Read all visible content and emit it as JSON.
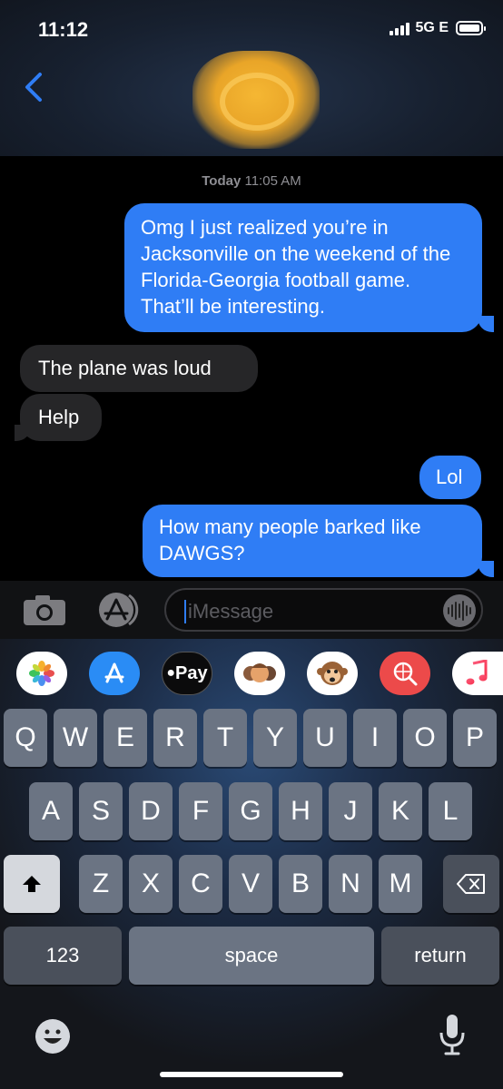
{
  "status_bar": {
    "time": "11:12",
    "network": "5G E",
    "signal_bars": 4,
    "battery_level": 1.0
  },
  "header": {
    "back_icon": "chevron-left-icon",
    "contact_avatar": "blurred-avatar"
  },
  "conversation": {
    "timestamp_day": "Today",
    "timestamp_time": "11:05 AM",
    "messages": [
      {
        "sender": "me",
        "text": "Omg I just realized you’re in Jacksonville on the weekend of the Florida-Georgia football game. That’ll be interesting."
      },
      {
        "sender": "them",
        "text": "The plane was loud"
      },
      {
        "sender": "them",
        "text": "Help"
      },
      {
        "sender": "me",
        "text": "Lol"
      },
      {
        "sender": "me",
        "text": "How many people barked like DAWGS?"
      }
    ]
  },
  "input_bar": {
    "camera_icon": "camera-icon",
    "apps_icon": "app-store-icon",
    "placeholder": "iMessage",
    "voice_icon": "audio-waveform-icon"
  },
  "app_drawer": [
    {
      "name": "photos-app",
      "icon": "photos-icon"
    },
    {
      "name": "app-store-app",
      "icon": "app-store-icon"
    },
    {
      "name": "apple-pay-app",
      "label": "Pay"
    },
    {
      "name": "memoji-app",
      "icon": "memoji-icon"
    },
    {
      "name": "animoji-app",
      "icon": "monkey-icon"
    },
    {
      "name": "web-search-app",
      "icon": "globe-search-icon"
    },
    {
      "name": "music-app",
      "icon": "music-note-icon"
    }
  ],
  "keyboard": {
    "row1": [
      "Q",
      "W",
      "E",
      "R",
      "T",
      "Y",
      "U",
      "I",
      "O",
      "P"
    ],
    "row2": [
      "A",
      "S",
      "D",
      "F",
      "G",
      "H",
      "J",
      "K",
      "L"
    ],
    "row3": [
      "Z",
      "X",
      "C",
      "V",
      "B",
      "N",
      "M"
    ],
    "shift_icon": "shift-arrow-icon",
    "delete_icon": "backspace-icon",
    "numbers_label": "123",
    "space_label": "space",
    "return_label": "return",
    "emoji_icon": "emoji-icon",
    "dictation_icon": "microphone-icon"
  },
  "colors": {
    "outgoing_bubble": "#2f7df5",
    "incoming_bubble": "#262628",
    "background": "#000000"
  }
}
